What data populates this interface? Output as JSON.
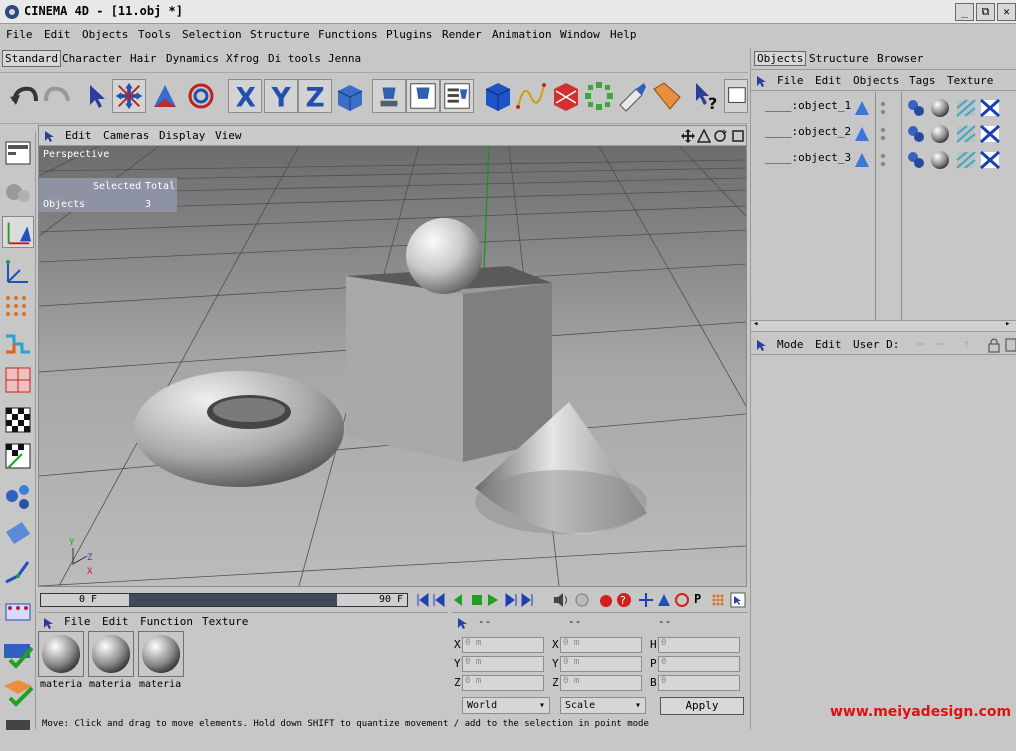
{
  "window": {
    "title": "CINEMA 4D - [11.obj *]",
    "minimize": "_",
    "restore": "⧉",
    "close": "✕"
  },
  "menu": [
    "File",
    "Edit",
    "Objects",
    "Tools",
    "Selection",
    "Structure",
    "Functions",
    "Plugins",
    "Render",
    "Animation",
    "Window",
    "Help"
  ],
  "palette_tabs": [
    "Standard",
    "Character",
    "Hair",
    "Dynamics",
    "Xfrog",
    "Di tools",
    "Jenna"
  ],
  "viewport": {
    "menu": [
      "Edit",
      "Cameras",
      "Display",
      "View"
    ],
    "label": "Perspective",
    "info": {
      "col_selected": "Selected",
      "col_total": "Total",
      "row_label": "Objects",
      "value": "3"
    }
  },
  "timeline": {
    "start": "0 F",
    "end": "90 F"
  },
  "material_manager": {
    "menu": [
      "File",
      "Edit",
      "Function",
      "Texture"
    ],
    "materials": [
      "materia",
      "materia",
      "materia"
    ]
  },
  "coordinates": {
    "headers": [
      "--",
      "--",
      "--"
    ],
    "rows": [
      {
        "l1": "X",
        "v1": "0 m",
        "l2": "X",
        "v2": "0 m",
        "l3": "H",
        "v3": "0"
      },
      {
        "l1": "Y",
        "v1": "0 m",
        "l2": "Y",
        "v2": "0 m",
        "l3": "P",
        "v3": "0"
      },
      {
        "l1": "Z",
        "v1": "0 m",
        "l2": "Z",
        "v2": "0 m",
        "l3": "B",
        "v3": "0"
      }
    ],
    "mode_select": "World",
    "scale_select": "Scale",
    "apply": "Apply"
  },
  "object_manager": {
    "tabs": [
      "Objects",
      "Structure",
      "Browser"
    ],
    "menu": [
      "File",
      "Edit",
      "Objects",
      "Tags",
      "Texture"
    ],
    "objects": [
      "____:object_1",
      "____:object_2",
      "____:object_3"
    ]
  },
  "attribute_manager": {
    "menu": [
      "Mode",
      "Edit",
      "User D:"
    ]
  },
  "status": "Move: Click and drag to move elements. Hold down SHIFT to quantize movement / add to the selection in point mode",
  "watermark": "www.meiyadesign.com"
}
